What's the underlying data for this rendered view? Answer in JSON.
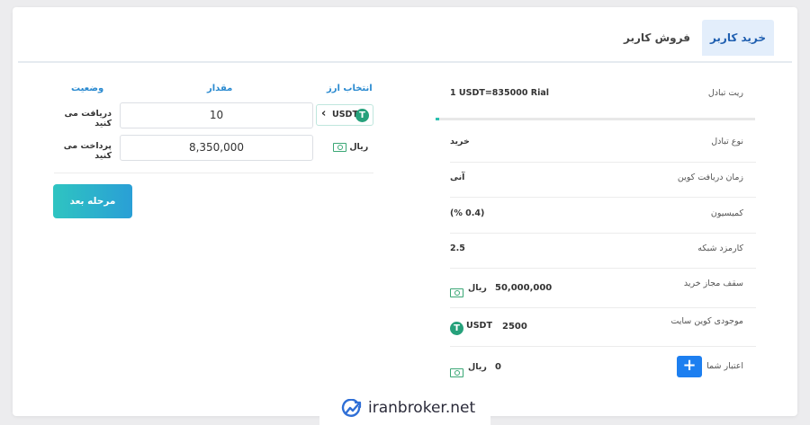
{
  "tabs": {
    "buy": "خرید کاربر",
    "sell": "فروش کاربر"
  },
  "info": {
    "exchange_rate": {
      "label": "ریت تبادل",
      "value": "1 USDT=835000 Rial"
    },
    "progress_fraction": 0.01,
    "trade_type": {
      "label": "نوع تبادل",
      "value": "خرید"
    },
    "receive_time": {
      "label": "زمان دریافت کوین",
      "value": "آنی"
    },
    "commission": {
      "label": "کمیسیون",
      "value": "(% 0.4)"
    },
    "network_fee": {
      "label": "کارمزد شبکه",
      "value": "2.5"
    },
    "buy_limit": {
      "label": "سقف مجاز خرید",
      "value": "50,000,000",
      "unit": "ریال"
    },
    "site_balance": {
      "label": "موجودی کوین سایت",
      "value": "2500",
      "unit": "USDT"
    },
    "your_credit": {
      "label": "اعتبار شما",
      "value": "0",
      "unit": "ریال",
      "add_label": "+"
    }
  },
  "form": {
    "headers": {
      "currency": "انتخاب ارز",
      "amount": "مقدار",
      "status": "وضعیت"
    },
    "receive": {
      "label": "دریافت می کنید",
      "value": "10",
      "currency": "USDT",
      "chevron": "‹"
    },
    "pay": {
      "label": "پرداخت می کنید",
      "value": "8,350,000",
      "currency": "ریال"
    },
    "next_button": "مرحله بعد"
  },
  "icons": {
    "tether": "T"
  },
  "colors": {
    "accent": "#1d7ff0",
    "tab_active_bg": "#e3eefb",
    "header_blue": "#2a8ad0",
    "tether_green": "#26a17b",
    "button_gradient_start": "#2ec4c1",
    "button_gradient_end": "#2a9fd6"
  },
  "watermark": "iranbroker.net"
}
